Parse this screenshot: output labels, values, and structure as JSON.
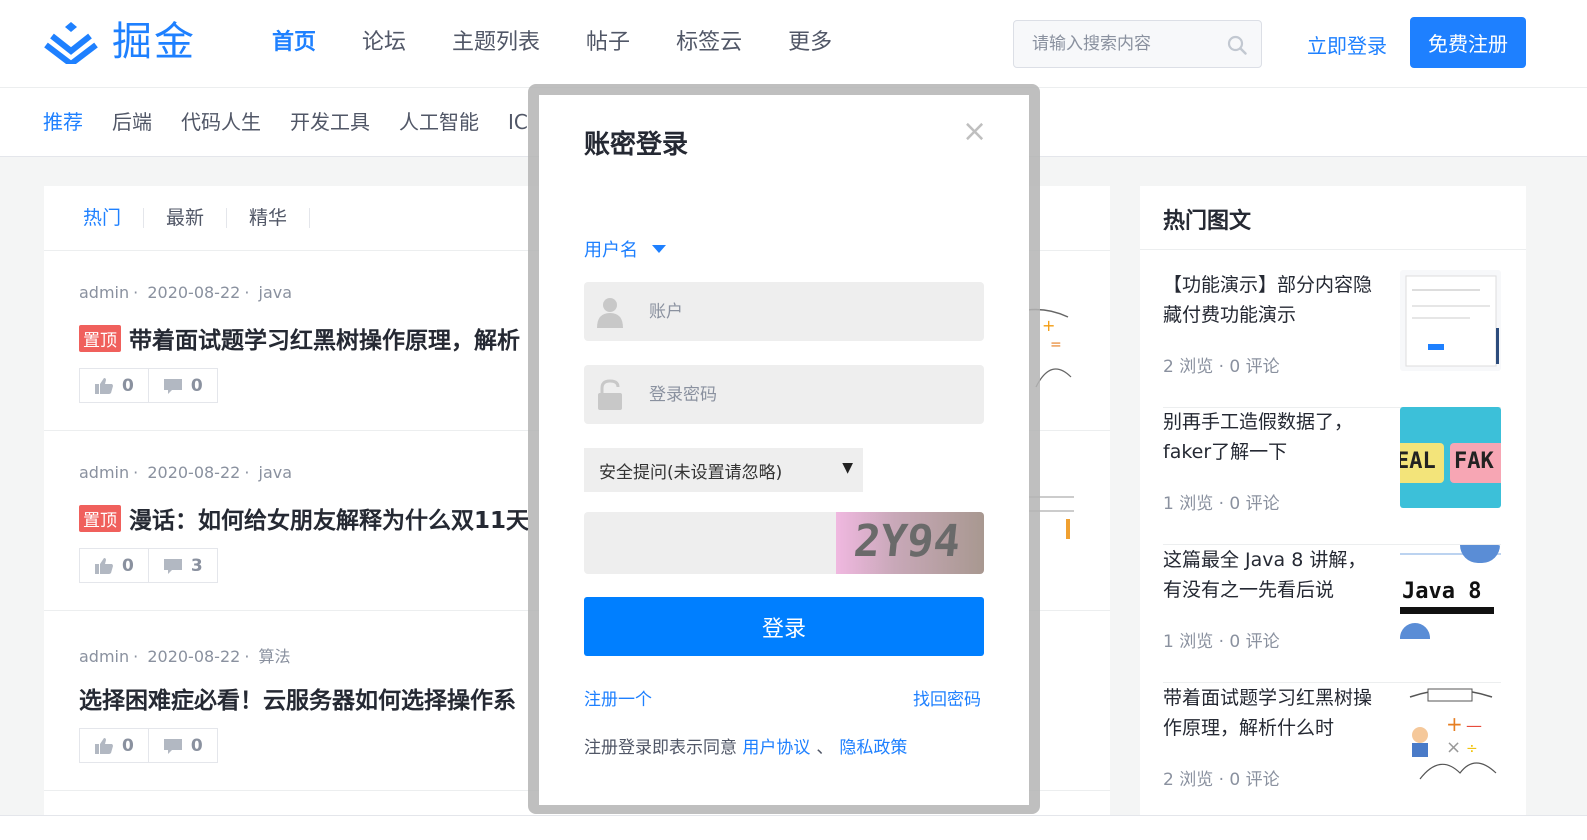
{
  "header": {
    "logo_text": "掘金",
    "nav": [
      "首页",
      "论坛",
      "主题列表",
      "帖子",
      "标签云",
      "更多"
    ],
    "search_placeholder": "请输入搜索内容",
    "login_label": "立即登录",
    "signup_label": "免费注册",
    "brand_color": "#1e80ff"
  },
  "subnav": [
    "推荐",
    "后端",
    "代码人生",
    "开发工具",
    "人工智能",
    "IC"
  ],
  "list": {
    "tabs": [
      "热门",
      "最新",
      "精华"
    ],
    "articles": [
      {
        "author": "admin",
        "date": "2020-08-22",
        "tag": "java",
        "pinned": "置顶",
        "title": "带着面试题学习红黑树操作原理，解析",
        "likes": "0",
        "comments": "0"
      },
      {
        "author": "admin",
        "date": "2020-08-22",
        "tag": "java",
        "pinned": "置顶",
        "title": "漫话：如何给女朋友解释为什么双11天",
        "likes": "0",
        "comments": "3"
      },
      {
        "author": "admin",
        "date": "2020-08-22",
        "tag": "算法",
        "pinned": "",
        "title": "选择困难症必看！云服务器如何选择操作系",
        "likes": "0",
        "comments": "0"
      }
    ]
  },
  "sidebar": {
    "title": "热门图文",
    "items": [
      {
        "title": "【功能演示】部分内容隐藏付费功能演示",
        "stats": "2 浏览 · 0 评论"
      },
      {
        "title": "别再手工造假数据了，faker了解一下",
        "stats": "1 浏览 · 0 评论"
      },
      {
        "title": "这篇最全 Java 8 讲解，有没有之一先看后说",
        "stats": "1 浏览 · 0 评论"
      },
      {
        "title": "带着面试题学习红黑树操作原理，解析什么时",
        "stats": "2 浏览 · 0 评论"
      }
    ],
    "thumb_text": {
      "fake_a": "EAL",
      "fake_b": "FAK",
      "java": "Java 8"
    }
  },
  "modal": {
    "title": "账密登录",
    "close": "×",
    "login_type": "用户名",
    "account_placeholder": "账户",
    "password_placeholder": "登录密码",
    "security_question": "安全提问(未设置请忽略)",
    "captcha_text": "2Y94",
    "submit_label": "登录",
    "register_link": "注册一个",
    "forgot_link": "找回密码",
    "agree_text": "注册登录即表示同意",
    "agreement_link": "用户协议",
    "separator": "、",
    "privacy_link": "隐私政策"
  }
}
